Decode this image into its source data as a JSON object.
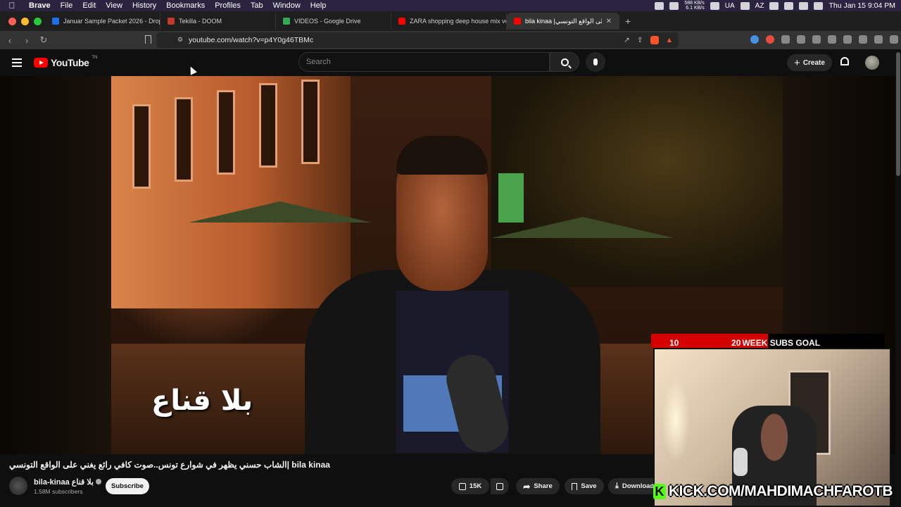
{
  "menubar": {
    "apple": "",
    "items": [
      "Brave",
      "File",
      "Edit",
      "View",
      "History",
      "Bookmarks",
      "Profiles",
      "Tab",
      "Window",
      "Help"
    ],
    "net_up": "588 KB/s",
    "net_down": "6.1 KB/s",
    "lang": "UA",
    "input": "AZ",
    "datetime": "Thu Jan 15  9:04 PM"
  },
  "tabs": [
    {
      "title": "Januar Sample Packet 2026 - Drop",
      "color": "#1f6feb"
    },
    {
      "title": "Tekilla - DOOM",
      "color": "#c0392b"
    },
    {
      "title": "VIDEOS - Google Drive",
      "color": "#34a853"
    },
    {
      "title": "ZARA shopping deep house mix vo",
      "color": "#ff0000"
    },
    {
      "title": "bila kinaa |على الواقع التونسي",
      "color": "#ff0000",
      "active": true
    }
  ],
  "address": {
    "url": "youtube.com/watch?v=p4Y0g46TBMc",
    "shields_count": "10"
  },
  "youtube": {
    "logo_text": "YouTube",
    "logo_suffix": "TN",
    "search_placeholder": "Search",
    "create_label": "Create"
  },
  "video": {
    "overlay_text": "بلا قناع",
    "subs_goal": {
      "label": "WEEK SUBS GOAL",
      "current": "10",
      "target": "20",
      "progress": 0.5
    },
    "kick_text": "KICK.COM/MAHDIMACHFAROTB",
    "kick_logo": "K"
  },
  "details": {
    "title": "الشاب حسني يظهر في شوارع تونس..صوت كافي رائع يغني على الواقع التونسي| bila kinaa",
    "channel_name": "bila-kinaa بلا قناع",
    "subscribers": "1.58M subscribers",
    "subscribe_label": "Subscribe",
    "likes": "15K",
    "share_label": "Share",
    "save_label": "Save",
    "download_label": "Download"
  },
  "colors": {
    "youtube_red": "#ff0000",
    "kick_green": "#53fc18",
    "goal_red": "#d40000"
  }
}
